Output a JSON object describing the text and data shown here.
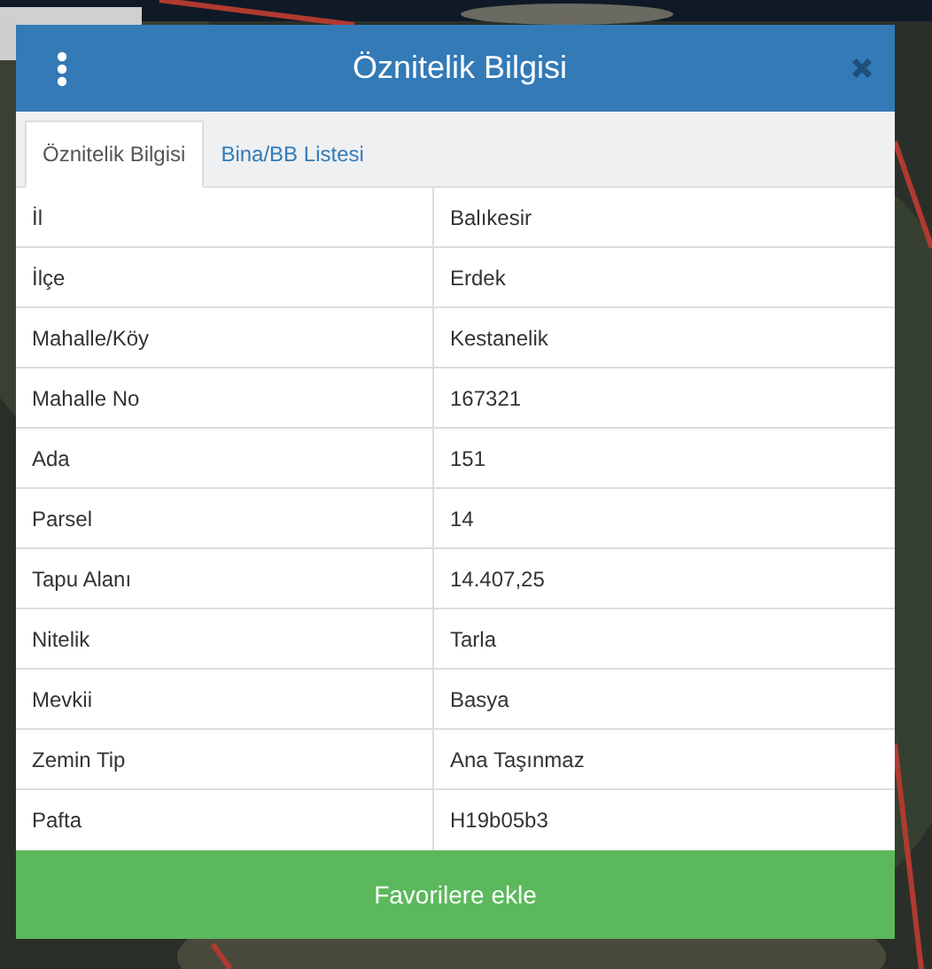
{
  "dialog": {
    "title": "Öznitelik Bilgisi"
  },
  "tabs": [
    {
      "label": "Öznitelik Bilgisi",
      "selected": true
    },
    {
      "label": "Bina/BB Listesi",
      "selected": false
    }
  ],
  "rows": [
    {
      "label": "İl",
      "value": "Balıkesir"
    },
    {
      "label": "İlçe",
      "value": "Erdek"
    },
    {
      "label": "Mahalle/Köy",
      "value": "Kestanelik"
    },
    {
      "label": "Mahalle No",
      "value": "167321"
    },
    {
      "label": "Ada",
      "value": "151"
    },
    {
      "label": "Parsel",
      "value": "14"
    },
    {
      "label": "Tapu Alanı",
      "value": "14.407,25"
    },
    {
      "label": "Nitelik",
      "value": "Tarla"
    },
    {
      "label": "Mevkii",
      "value": "Basya"
    },
    {
      "label": "Zemin Tip",
      "value": "Ana Taşınmaz"
    },
    {
      "label": "Pafta",
      "value": "H19b05b3"
    }
  ],
  "button": "Favorilere ekle"
}
